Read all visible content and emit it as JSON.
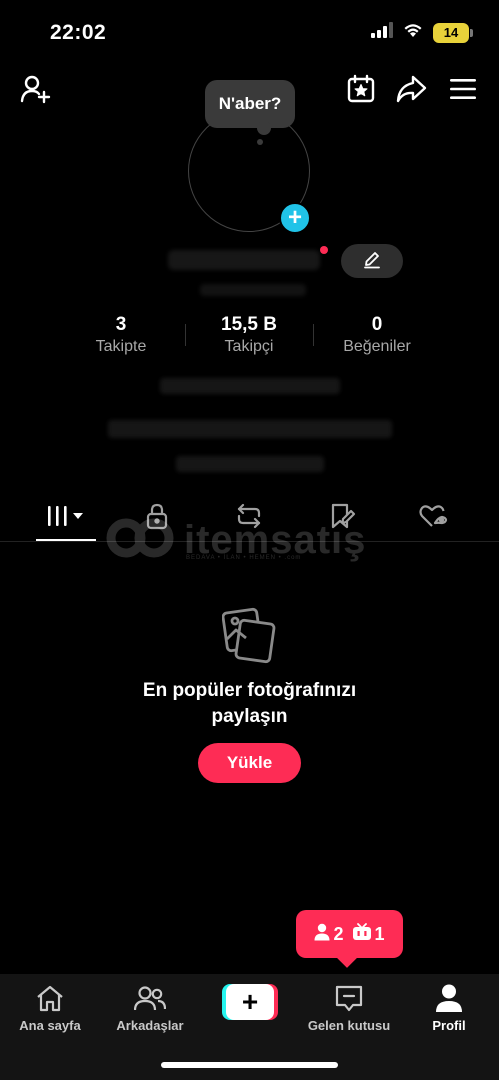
{
  "status_bar": {
    "time": "22:02",
    "battery": "14",
    "icons": [
      "signal-icon",
      "wifi-icon",
      "battery-icon"
    ]
  },
  "header": {
    "icons": [
      "add-friend-icon",
      "calendar-star-icon",
      "share-icon",
      "menu-icon"
    ]
  },
  "profile": {
    "tooltip": "N'aber?",
    "name_dot_color": "#fe2c55",
    "add_button_color": "#20c3e8"
  },
  "stats": [
    {
      "value": "3",
      "label": "Takipte"
    },
    {
      "value": "15,5 B",
      "label": "Takipçi"
    },
    {
      "value": "0",
      "label": "Beğeniler"
    }
  ],
  "tabs": {
    "items": [
      "videos-grid-icon",
      "lock-icon",
      "repost-icon",
      "saved-icon",
      "liked-icon"
    ],
    "active": 0
  },
  "watermark": {
    "text": "itemsatış",
    "sub": "BEDAVA • İLAN • HEMEN • .com"
  },
  "empty_state": {
    "title_line1": "En popüler fotoğrafınızı",
    "title_line2": "paylaşın",
    "button": "Yükle"
  },
  "notification": {
    "followers_count": "2",
    "live_count": "1",
    "color": "#fe2c55"
  },
  "bottom_nav": {
    "items": [
      {
        "label": "Ana sayfa",
        "icon": "home-icon"
      },
      {
        "label": "Arkadaşlar",
        "icon": "friends-icon"
      },
      {
        "label": "",
        "icon": "create-icon"
      },
      {
        "label": "Gelen kutusu",
        "icon": "inbox-icon"
      },
      {
        "label": "Profil",
        "icon": "profile-icon"
      }
    ],
    "active": 4
  }
}
